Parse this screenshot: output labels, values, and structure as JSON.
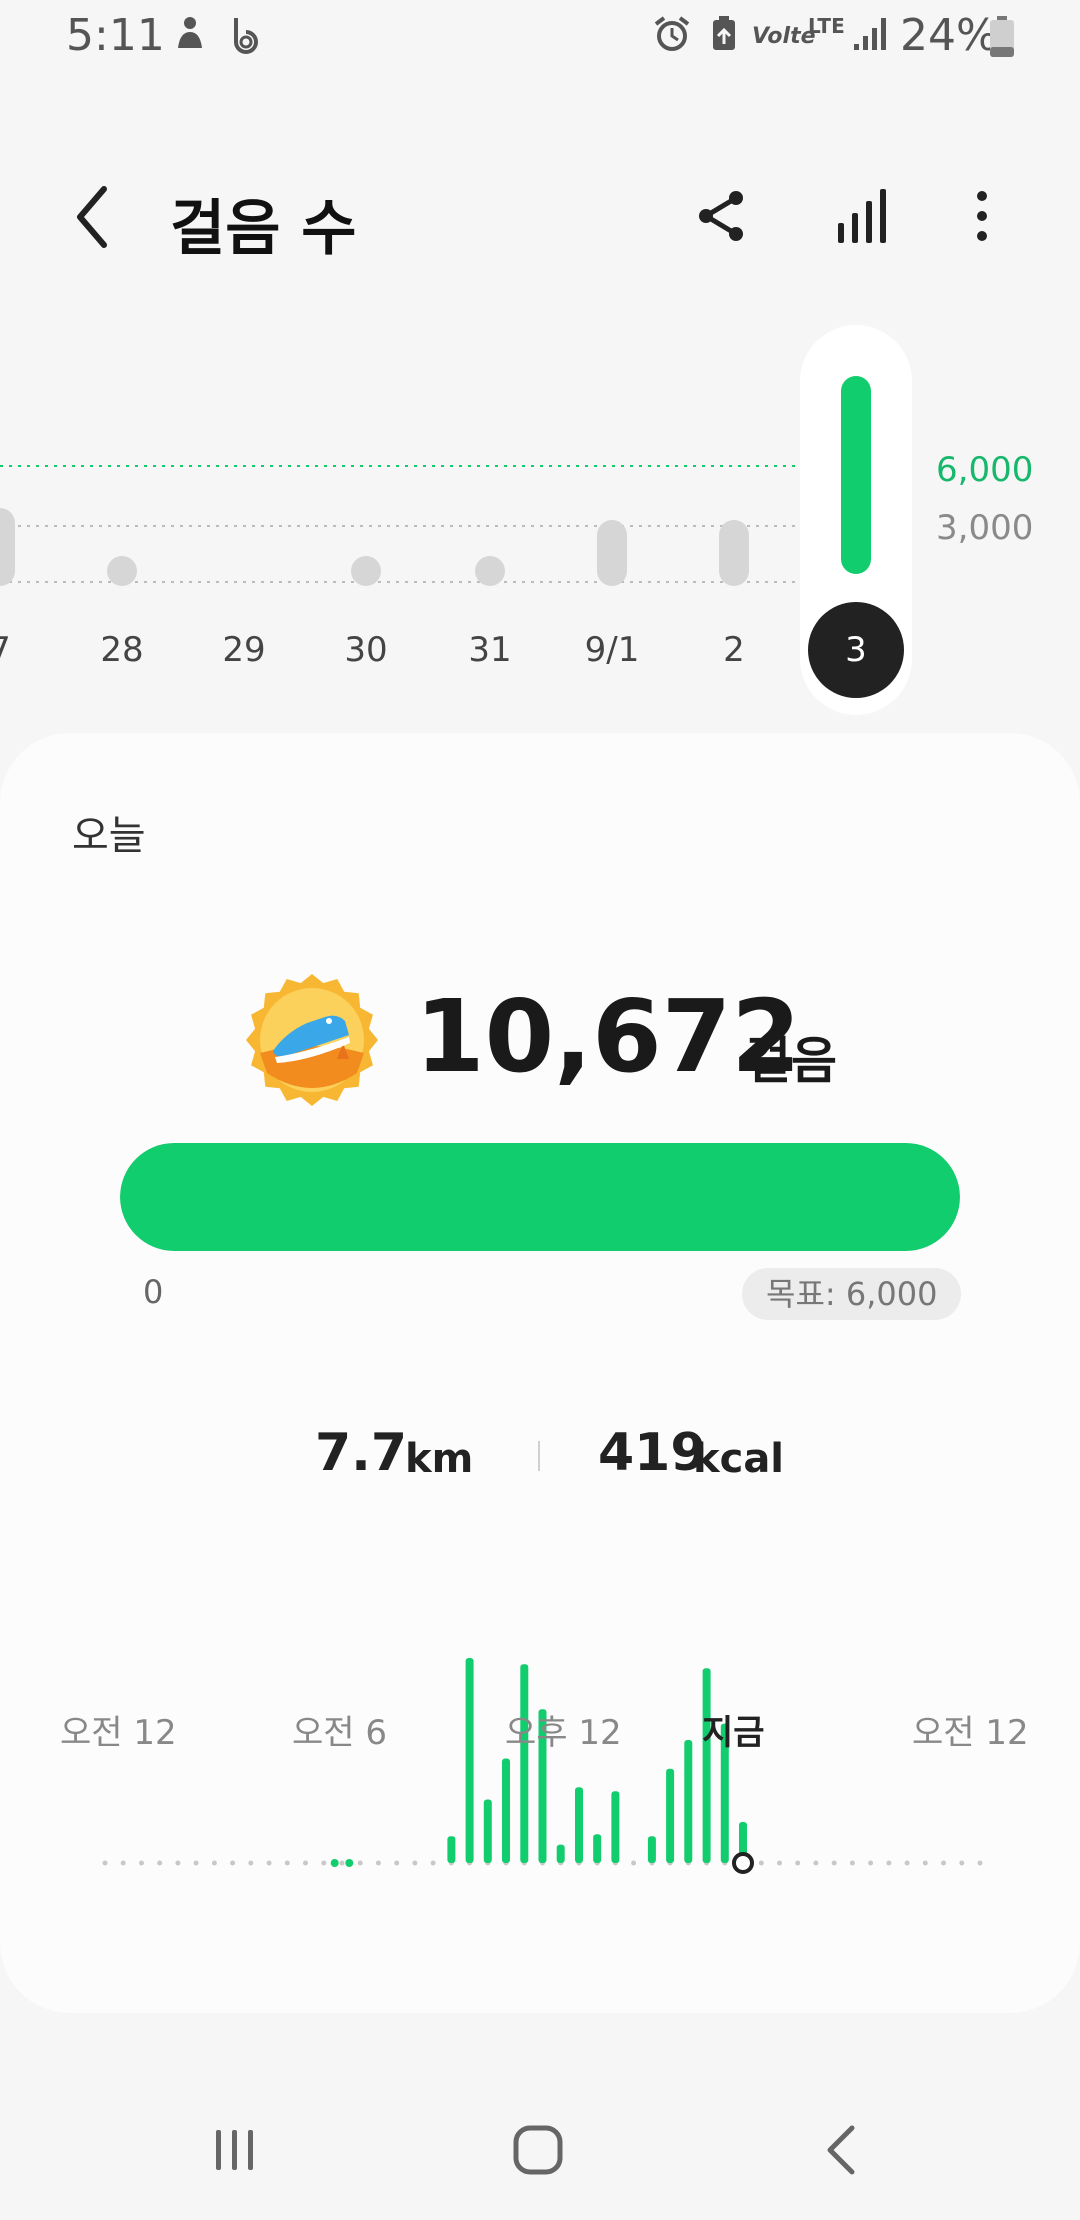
{
  "status_bar": {
    "time": "5:11",
    "volte_label": "Volte",
    "network_label": "LTE",
    "battery_percent": "24%"
  },
  "header": {
    "title": "걸음 수"
  },
  "history": {
    "goal_tick": "6,000",
    "half_tick": "3,000",
    "days": [
      {
        "label": "7",
        "level": 0.13
      },
      {
        "label": "28",
        "level": 0.0
      },
      {
        "label": "29",
        "level": null
      },
      {
        "label": "30",
        "level": 0.0
      },
      {
        "label": "31",
        "level": 0.0
      },
      {
        "label": "9/1",
        "level": 0.11
      },
      {
        "label": "2",
        "level": 0.11
      },
      {
        "label": "3",
        "level": 1.0,
        "selected": true
      }
    ]
  },
  "today": {
    "label": "오늘",
    "steps": "10,672",
    "steps_unit": "걸음",
    "progress_fraction": 1.0,
    "progress_start": "0",
    "goal": "목표: 6,000",
    "distance": "7.7",
    "distance_unit": "km",
    "calories": "419",
    "calories_unit": "kcal"
  },
  "hourly": {
    "axis_labels": [
      "오전 12",
      "오전 6",
      "오후 12",
      "지금",
      "오전 12"
    ],
    "bars": [
      {
        "hour": 6.3,
        "v": 0.02
      },
      {
        "hour": 6.7,
        "v": 0.02
      },
      {
        "hour": 9.5,
        "v": 0.13
      },
      {
        "hour": 10.0,
        "v": 1.0
      },
      {
        "hour": 10.5,
        "v": 0.31
      },
      {
        "hour": 11.0,
        "v": 0.51
      },
      {
        "hour": 11.5,
        "v": 0.97
      },
      {
        "hour": 12.0,
        "v": 0.75
      },
      {
        "hour": 12.5,
        "v": 0.09
      },
      {
        "hour": 13.0,
        "v": 0.37
      },
      {
        "hour": 13.5,
        "v": 0.14
      },
      {
        "hour": 14.0,
        "v": 0.35
      },
      {
        "hour": 15.0,
        "v": 0.13
      },
      {
        "hour": 15.5,
        "v": 0.46
      },
      {
        "hour": 16.0,
        "v": 0.6
      },
      {
        "hour": 16.5,
        "v": 0.95
      },
      {
        "hour": 17.0,
        "v": 0.68
      },
      {
        "hour": 17.5,
        "v": 0.2
      }
    ],
    "now_hour": 17.5
  },
  "colors": {
    "accent": "#12cd6d",
    "inactive_bar": "#d6d6d6",
    "selected_day": "#222222"
  }
}
